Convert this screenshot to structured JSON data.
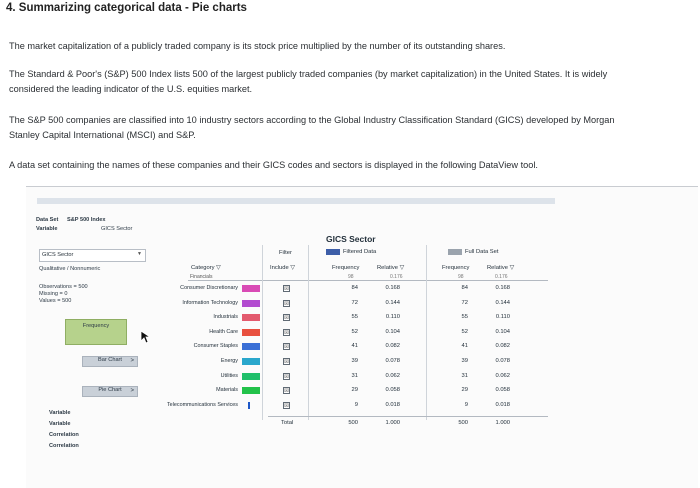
{
  "question": {
    "title": "4. Summarizing categorical data - Pie charts",
    "p1": "The market capitalization of a publicly traded company is its stock price multiplied by the number of its outstanding shares.",
    "p2_line1": "The Standard & Poor's (S&P) 500 Index lists 500 of the largest publicly traded companies (by market capitalization) in the United States. It is widely",
    "p2_line2": "considered the leading indicator of the U.S. equities market.",
    "p3_line1": "The S&P 500 companies are classified into 10 industry sectors according to the Global Industry Classification Standard (GICS) developed by Morgan",
    "p3_line2": "Stanley Capital International (MSCI) and S&P.",
    "p4": "A data set containing the names of these companies and their GICS codes and sectors is displayed in the following DataView tool."
  },
  "dataview": {
    "data_set_label": "Data Set",
    "data_set_value": "S&P 500 Index",
    "variable_label": "Variable",
    "variable_value": "GICS Sector",
    "selected_variable": "GICS Sector",
    "type": "Qualitative / Nonnumeric",
    "observations": "Observations = 500",
    "missing": "Missing = 0",
    "values": "Values = 500",
    "frequency_button": "Frequency",
    "bar_chart_button": "Bar Chart",
    "pie_chart_button": "Pie Chart",
    "arrow": ">",
    "footer": [
      "Variable",
      "Variable",
      "Correlation",
      "Correlation"
    ]
  },
  "table": {
    "title": "GICS Sector",
    "filter_label": "Filter",
    "include_label": "Include",
    "category_label": "Category",
    "filtered_label": "Filtered Data",
    "full_label": "Full Data Set",
    "frequency_label": "Frequency",
    "relative_label": "Relative",
    "total_label": "Total",
    "filtered_total_freq": "500",
    "filtered_total_rel": "1.000",
    "full_total_freq": "500",
    "full_total_rel": "1.000",
    "partial_top_category": "Financials",
    "partial_top_freq": "98",
    "partial_top_rel": "0.176",
    "rows": [
      {
        "category": "Consumer Discretionary",
        "color": "#d94bb5",
        "include": "☒",
        "freq": "84",
        "rel": "0.168",
        "full_freq": "84",
        "full_rel": "0.168"
      },
      {
        "category": "Information Technology",
        "color": "#b24bd0",
        "include": "☒",
        "freq": "72",
        "rel": "0.144",
        "full_freq": "72",
        "full_rel": "0.144"
      },
      {
        "category": "Industrials",
        "color": "#e35a6e",
        "include": "☒",
        "freq": "55",
        "rel": "0.110",
        "full_freq": "55",
        "full_rel": "0.110"
      },
      {
        "category": "Health Care",
        "color": "#e8503f",
        "include": "☒",
        "freq": "52",
        "rel": "0.104",
        "full_freq": "52",
        "full_rel": "0.104"
      },
      {
        "category": "Consumer Staples",
        "color": "#3a6fd6",
        "include": "☒",
        "freq": "41",
        "rel": "0.082",
        "full_freq": "41",
        "full_rel": "0.082"
      },
      {
        "category": "Energy",
        "color": "#2aa7cc",
        "include": "☒",
        "freq": "39",
        "rel": "0.078",
        "full_freq": "39",
        "full_rel": "0.078"
      },
      {
        "category": "Utilities",
        "color": "#1fbf6a",
        "include": "☒",
        "freq": "31",
        "rel": "0.062",
        "full_freq": "31",
        "full_rel": "0.062"
      },
      {
        "category": "Materials",
        "color": "#22c24a",
        "include": "☒",
        "freq": "29",
        "rel": "0.058",
        "full_freq": "29",
        "full_rel": "0.058"
      },
      {
        "category": "Telecommunications Services",
        "color": "#1d58c8",
        "include": "☒",
        "freq": "9",
        "rel": "0.018",
        "full_freq": "9",
        "full_rel": "0.018"
      }
    ],
    "sort_icon": "▽",
    "filtered_swatch_color": "#3d5ea8",
    "full_swatch_color": "#9aa3ad"
  }
}
